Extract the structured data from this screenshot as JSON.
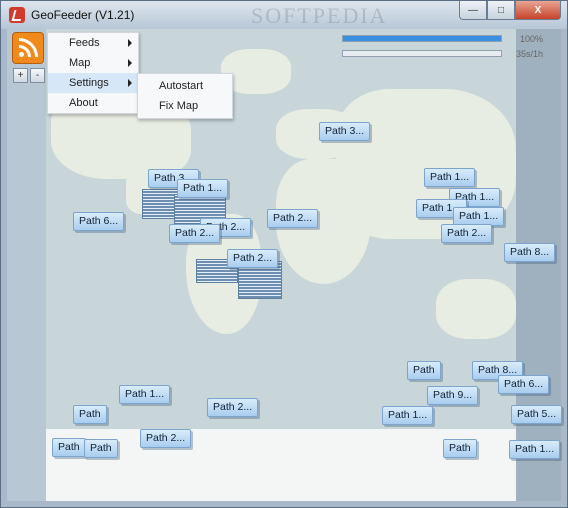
{
  "window": {
    "title": "GeoFeeder (V1.21)"
  },
  "controls": {
    "zoom_in": "+",
    "zoom_out": "-",
    "minimize": "—",
    "maximize": "□",
    "close": "X"
  },
  "progress": [
    {
      "percent": 100,
      "label": "100%"
    },
    {
      "percent": 0,
      "label": "35s/1h"
    }
  ],
  "menu": {
    "items": [
      "Feeds",
      "Map",
      "Settings",
      "About"
    ]
  },
  "submenu": {
    "items": [
      "Autostart",
      "Fix Map"
    ]
  },
  "watermark": "SOFTPEDIA",
  "paths": [
    "Path 3...",
    "Path 3...",
    "Path 1...",
    "Path 6...",
    "Path 2...",
    "Path 2...",
    "Path 2...",
    "Path 2...",
    "Path 1...",
    "Path 1...",
    "Path 1...",
    "Path 1...",
    "Path 2...",
    "Path 8...",
    "Path 1...",
    "Path 2...",
    "Path 2...",
    "Path",
    "Path",
    "Path",
    "Path 8...",
    "Path 6...",
    "Path 9...",
    "Path 1...",
    "Path 5...",
    "Path 1...",
    "Path",
    "Path"
  ]
}
